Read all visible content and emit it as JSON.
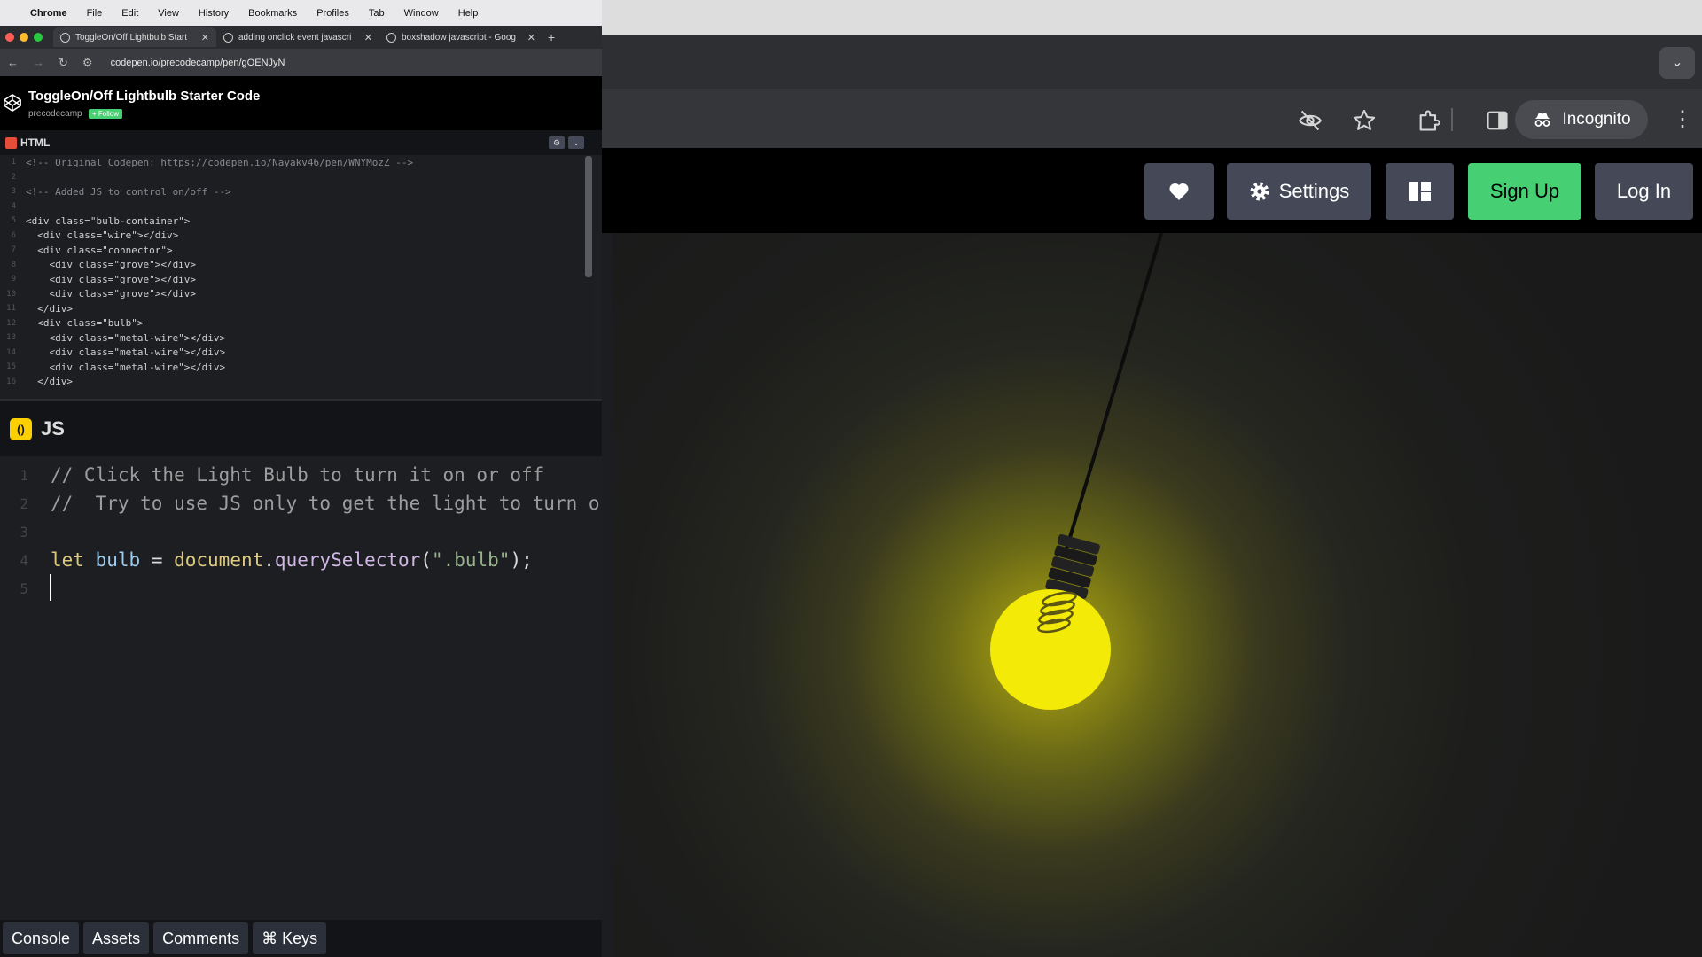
{
  "menubar": {
    "app": "Chrome",
    "items": [
      "File",
      "Edit",
      "View",
      "History",
      "Bookmarks",
      "Profiles",
      "Tab",
      "Window",
      "Help"
    ]
  },
  "tabs": [
    {
      "title": "ToggleOn/Off Lightbulb Start",
      "active": true
    },
    {
      "title": "adding onclick event javascri",
      "active": false
    },
    {
      "title": "boxshadow javascript - Goog",
      "active": false
    }
  ],
  "address": {
    "url": "codepen.io/precodecamp/pen/gOENJyN"
  },
  "codepen": {
    "title": "ToggleOn/Off Lightbulb Starter Code",
    "user": "precodecamp",
    "follow_label": "+ Follow"
  },
  "html_editor": {
    "label": "HTML",
    "lines": [
      {
        "n": "1",
        "text": "<!-- Original Codepen: https://codepen.io/Nayakv46/pen/WNYMozZ -->",
        "comment": true
      },
      {
        "n": "2",
        "text": "",
        "comment": false
      },
      {
        "n": "3",
        "text": "<!-- Added JS to control on/off -->",
        "comment": true
      },
      {
        "n": "4",
        "text": "",
        "comment": false
      },
      {
        "n": "5",
        "text": "<div class=\"bulb-container\">",
        "comment": false
      },
      {
        "n": "6",
        "text": "  <div class=\"wire\"></div>",
        "comment": false
      },
      {
        "n": "7",
        "text": "  <div class=\"connector\">",
        "comment": false
      },
      {
        "n": "8",
        "text": "    <div class=\"grove\"></div>",
        "comment": false
      },
      {
        "n": "9",
        "text": "    <div class=\"grove\"></div>",
        "comment": false
      },
      {
        "n": "10",
        "text": "    <div class=\"grove\"></div>",
        "comment": false
      },
      {
        "n": "11",
        "text": "  </div>",
        "comment": false
      },
      {
        "n": "12",
        "text": "  <div class=\"bulb\">",
        "comment": false
      },
      {
        "n": "13",
        "text": "    <div class=\"metal-wire\"></div>",
        "comment": false
      },
      {
        "n": "14",
        "text": "    <div class=\"metal-wire\"></div>",
        "comment": false
      },
      {
        "n": "15",
        "text": "    <div class=\"metal-wire\"></div>",
        "comment": false
      },
      {
        "n": "16",
        "text": "  </div>",
        "comment": false
      }
    ]
  },
  "js_editor": {
    "label": "JS",
    "line1": "// Click the Light Bulb to turn it on or off",
    "line2": "//  Try to use JS only to get the light to turn o",
    "line4": {
      "kw": "let",
      "var": "bulb",
      "op": " = ",
      "obj": "document",
      "dot": ".",
      "method": "querySelector",
      "open": "(",
      "str": "\".bulb\"",
      "close": ");"
    }
  },
  "bottom_bar": {
    "console": "Console",
    "assets": "Assets",
    "comments": "Comments",
    "keys": "⌘ Keys"
  },
  "right_toolbar": {
    "incognito": "Incognito"
  },
  "codepen_actions": {
    "settings": "Settings",
    "signup": "Sign Up",
    "login": "Log In"
  },
  "icons": {
    "eye_off": "eye-off-icon",
    "star": "star-icon",
    "extensions": "puzzle-icon",
    "sidepanel": "side-panel-icon",
    "heart": "heart-icon",
    "gear": "gear-icon",
    "layout": "layout-icon"
  },
  "colors": {
    "accent_green": "#47cf73",
    "bulb_yellow": "#f4ea08",
    "html_badge": "#e44d3a",
    "js_badge": "#fcd000"
  }
}
